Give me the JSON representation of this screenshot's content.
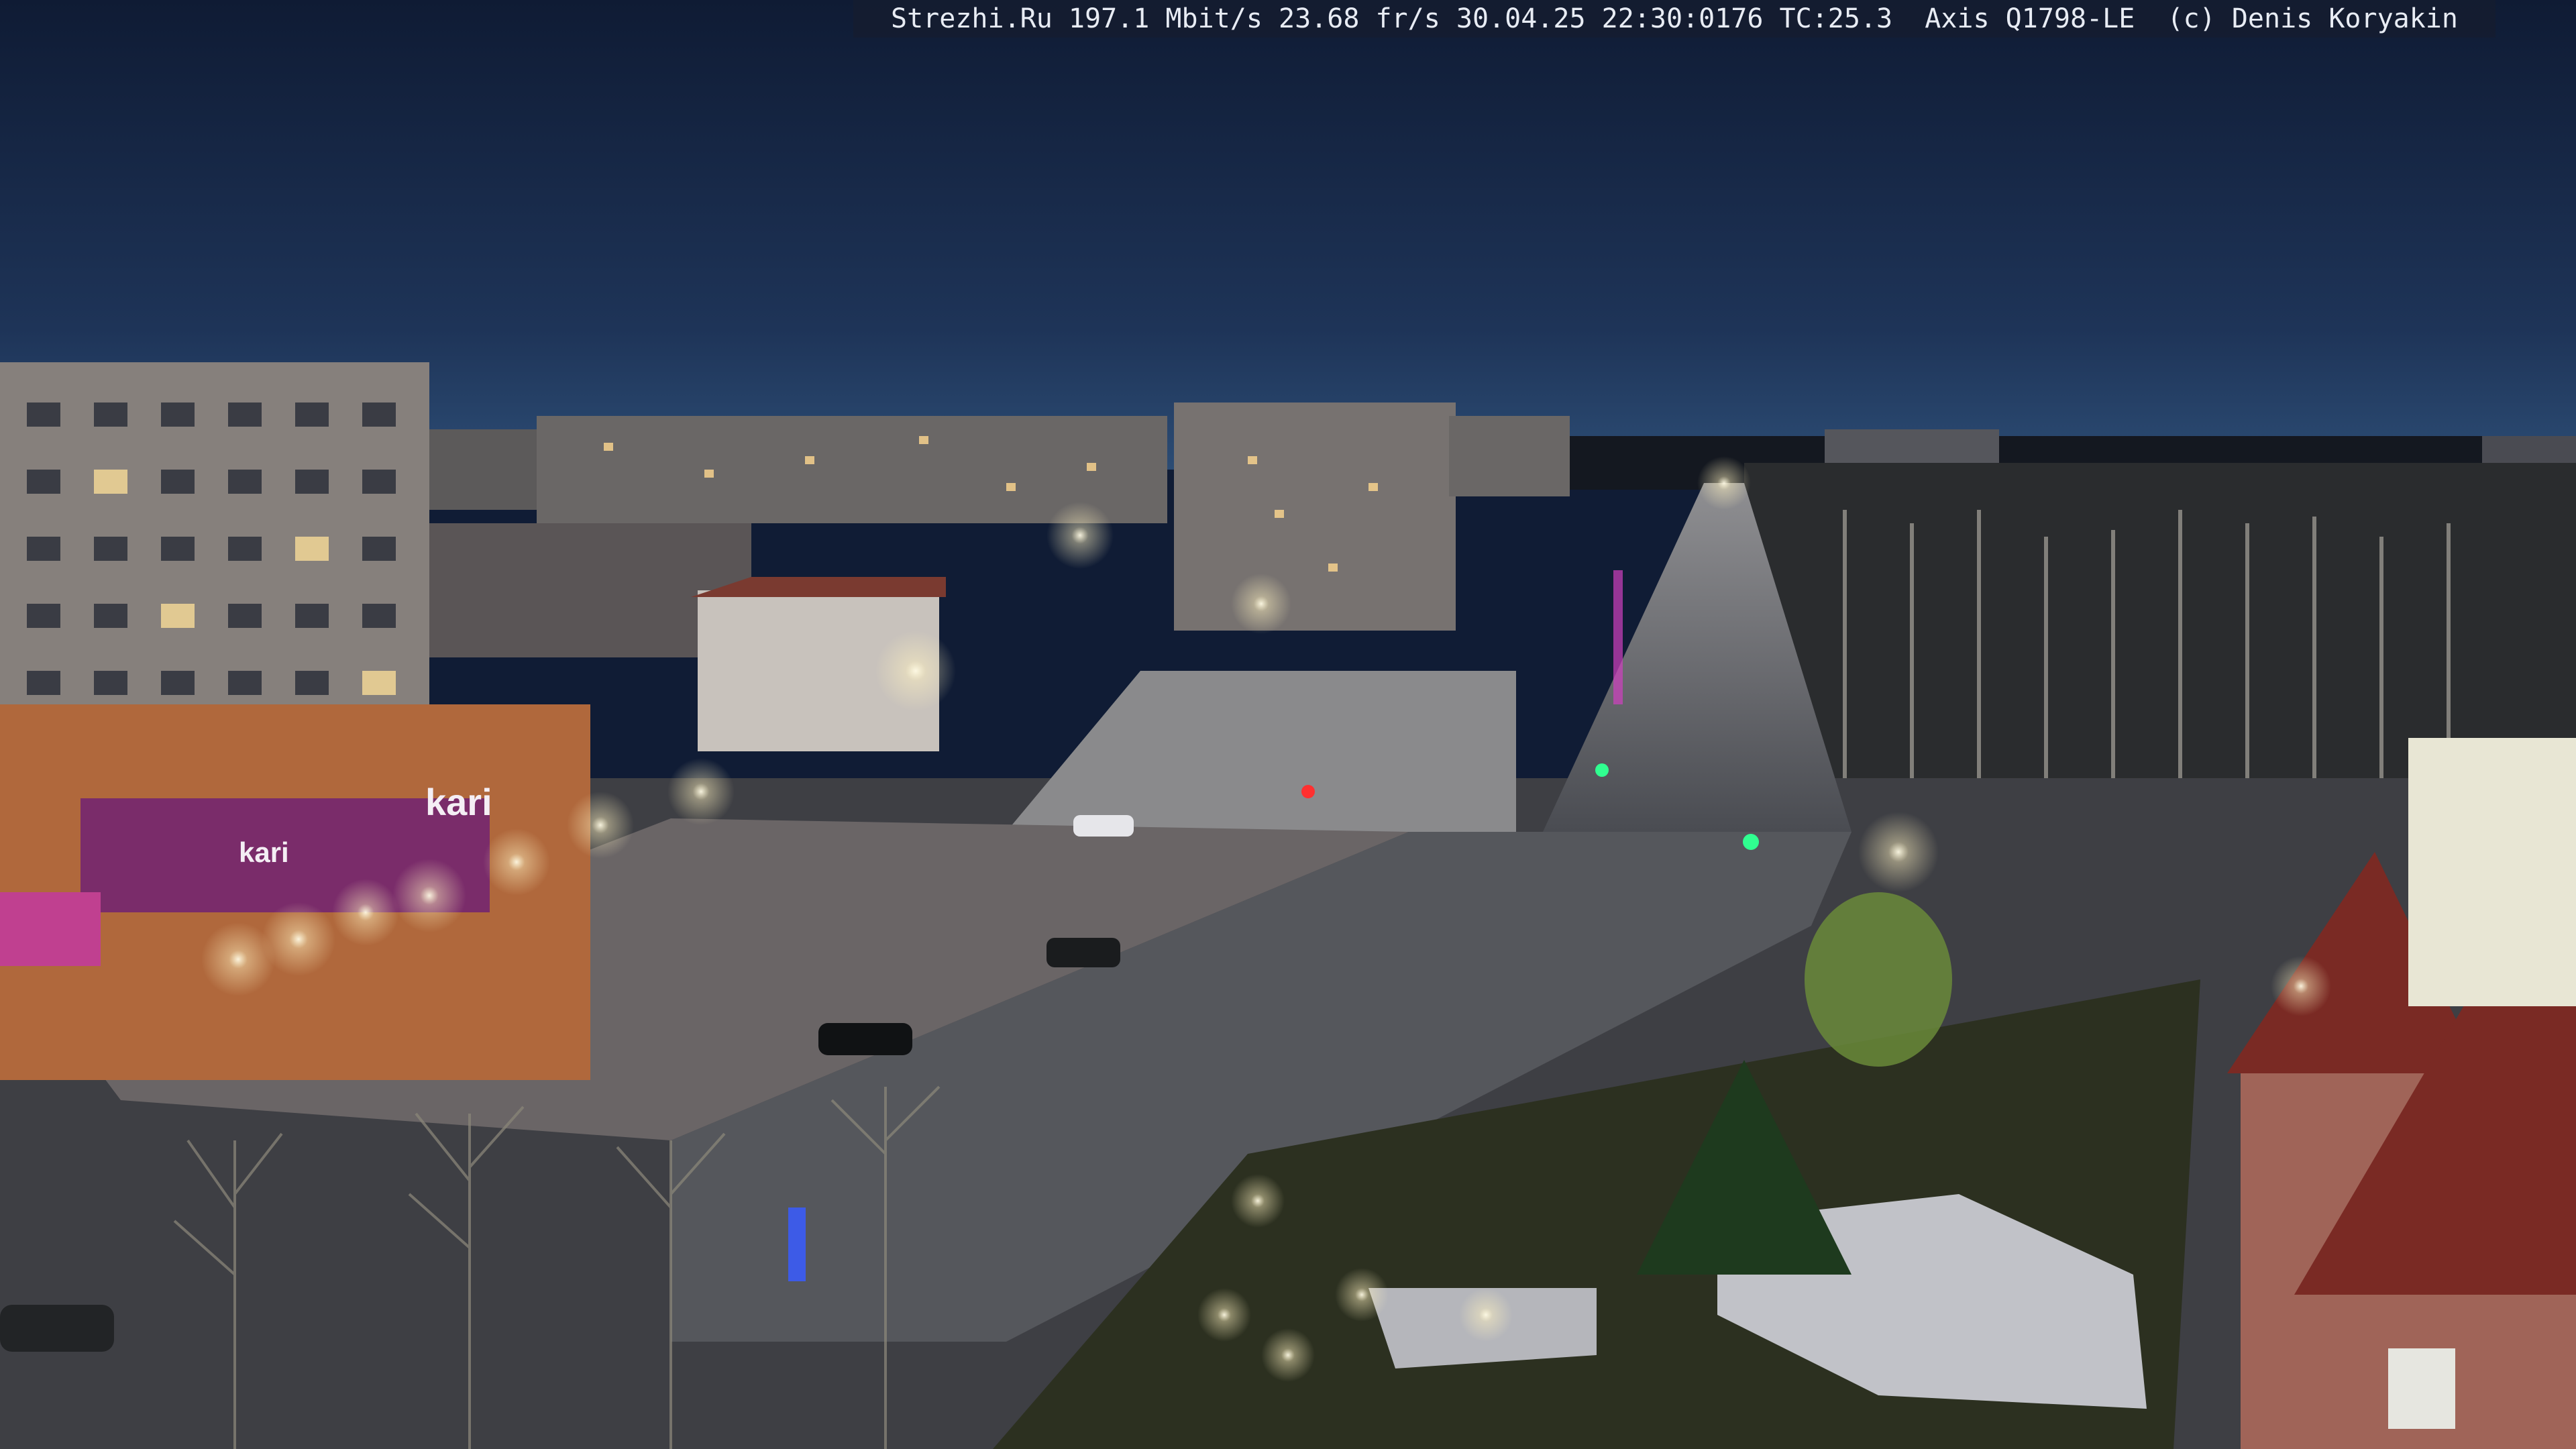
{
  "overlay": {
    "caption": "Strezhi.Ru 197.1 Mbit/s 23.68 fr/s 30.04.25 22:30:0176 TC:25.3  Axis Q1798-LE  (c) Denis Koryakin"
  },
  "signage": {
    "store_sign": "kari",
    "store_sign_small": "kari"
  },
  "palette": {
    "sky_top": "#0f1b34",
    "sky_horizon": "#28476e",
    "road": "#4f525a",
    "lamp": "#fff6d8",
    "neon_pink": "#d040c0",
    "neon_blue": "#4080ff"
  }
}
